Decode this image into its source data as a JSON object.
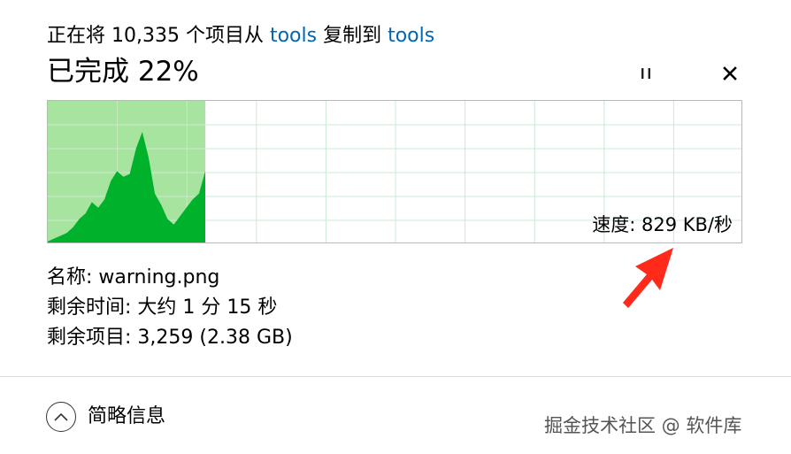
{
  "header": {
    "prefix": "正在将 10,335 个项目从 ",
    "source": "tools",
    "middle": " 复制到 ",
    "destination": "tools"
  },
  "progress": {
    "label": "已完成 22%",
    "fraction": 0.22
  },
  "controls": {
    "pause_icon": "pause-icon",
    "close_icon": "close-icon"
  },
  "graph": {
    "speed": "速度: 829 KB/秒",
    "fill_color": "#00b12b",
    "done_color": "#a6e4a0",
    "grid_color": "#cde8d5"
  },
  "info": {
    "name": "名称: warning.png",
    "time_remaining": "剩余时间: 大约 1 分 15 秒",
    "items_remaining": "剩余项目: 3,259 (2.38 GB)"
  },
  "footer": {
    "details_label": "简略信息",
    "details_icon": "chevron-up-icon"
  },
  "watermark": "掘金技术社区 @ 软件库",
  "annotation": {
    "arrow_color": "#ff2a1a"
  }
}
